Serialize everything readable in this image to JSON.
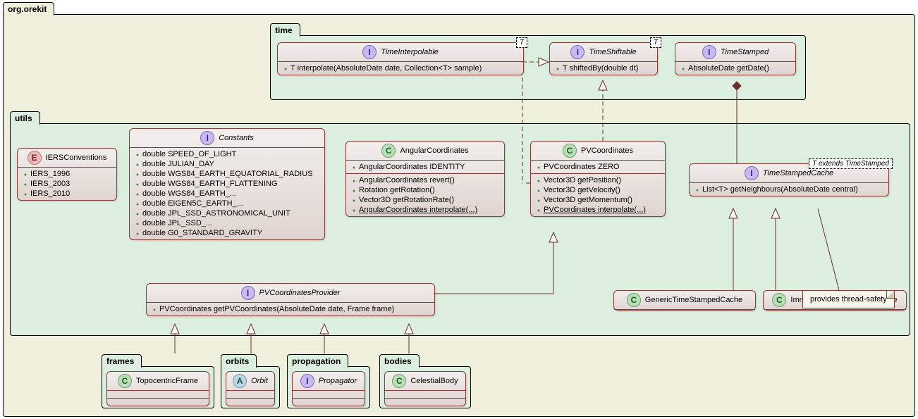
{
  "packages": {
    "root": "org.orekit",
    "time": "time",
    "utils": "utils",
    "frames": "frames",
    "orbits": "orbits",
    "propagation": "propagation",
    "bodies": "bodies"
  },
  "time": {
    "TimeInterpolable": {
      "name": "TimeInterpolable",
      "typeparam": "T",
      "methods": [
        "T interpolate(AbsoluteDate date, Collection<T> sample)"
      ]
    },
    "TimeShiftable": {
      "name": "TimeShiftable",
      "typeparam": "T",
      "methods": [
        "T shiftedBy(double dt)"
      ]
    },
    "TimeStamped": {
      "name": "TimeStamped",
      "methods": [
        "AbsoluteDate getDate()"
      ]
    }
  },
  "utils": {
    "IERSConventions": {
      "name": "IERSConventions",
      "values": [
        "IERS_1996",
        "IERS_2003",
        "IERS_2010"
      ]
    },
    "Constants": {
      "name": "Constants",
      "fields": [
        "double SPEED_OF_LIGHT",
        "double JULIAN_DAY",
        "double WGS84_EARTH_EQUATORIAL_RADIUS",
        "double WGS84_EARTH_FLATTENING",
        "double WGS84_EARTH_...",
        "double EIGEN5C_EARTH_...",
        "double JPL_SSD_ASTRONOMICAL_UNIT",
        "double JPL_SSD_...",
        "double G0_STANDARD_GRAVITY"
      ]
    },
    "AngularCoordinates": {
      "name": "AngularCoordinates",
      "fields": [
        "AngularCoordinates IDENTITY"
      ],
      "methods": [
        "AngularCoordinates revert()",
        "Rotation getRotation()",
        "Vector3D getRotationRate()",
        "AngularCoordinates interpolate(...)"
      ]
    },
    "PVCoordinates": {
      "name": "PVCoordinates",
      "fields": [
        "PVCoordinates ZERO"
      ],
      "methods": [
        "Vector3D getPosition()",
        "Vector3D getVelocity()",
        "Vector3D getMomentum()",
        "PVCoordinates interpolate(...)"
      ]
    },
    "TimeStampedCache": {
      "name": "TimeStampedCache",
      "typeparam": "T extends TimeStamped",
      "methods": [
        "List<T> getNeighbours(AbsoluteDate central)"
      ]
    },
    "PVCoordinatesProvider": {
      "name": "PVCoordinatesProvider",
      "methods": [
        "PVCoordinates getPVCoordinates(AbsoluteDate date, Frame frame)"
      ]
    },
    "GenericTimeStampedCache": {
      "name": "GenericTimeStampedCache"
    },
    "ImmutableTimeStampedCache": {
      "name": "ImmutableTimeStampedCache"
    }
  },
  "frames": {
    "TopocentricFrame": "TopocentricFrame"
  },
  "orbits": {
    "Orbit": "Orbit"
  },
  "propagation": {
    "Propagator": "Propagator"
  },
  "bodies": {
    "CelestialBody": "CelestialBody"
  },
  "note": "provides thread-safety"
}
